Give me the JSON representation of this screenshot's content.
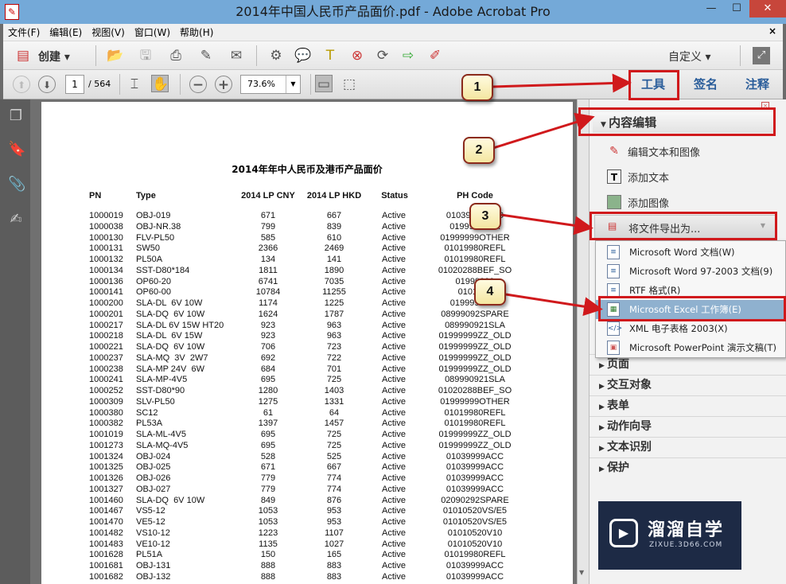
{
  "window": {
    "title": "2014年中国人民币产品面价.pdf - Adobe Acrobat Pro",
    "minimize": "—",
    "maximize": "☐",
    "close": "✕"
  },
  "menu": {
    "items": [
      "文件(F)",
      "编辑(E)",
      "视图(V)",
      "窗口(W)",
      "帮助(H)"
    ],
    "close": "×"
  },
  "toolbar": {
    "create_label": "创建 ▾",
    "customize_label": "自定义 ▾",
    "icons": [
      "open-icon",
      "save-icon",
      "print-icon",
      "edit-icon",
      "email-icon",
      "gear-icon",
      "comment-icon",
      "typewriter-icon",
      "delete-page-icon",
      "ocr-icon",
      "export-icon",
      "edit-pdf-icon"
    ]
  },
  "nav": {
    "page_current": "1",
    "page_total": "/ 564",
    "zoom": "73.6%"
  },
  "right_tabs": {
    "tools": "工具",
    "sign": "签名",
    "comment": "注释"
  },
  "panel": {
    "section_title": "内容编辑",
    "items": [
      "编辑文本和图像",
      "添加文本",
      "添加图像"
    ],
    "export_label": "将文件导出为...",
    "export_options": [
      "Microsoft Word 文档(W)",
      "Microsoft Word 97-2003 文档(9)",
      "RTF 格式(R)",
      "Microsoft Excel 工作簿(E)",
      "XML 电子表格 2003(X)",
      "Microsoft PowerPoint 演示文稿(T)"
    ],
    "sections": [
      "页面",
      "交互对象",
      "表单",
      "动作向导",
      "文本识别",
      "保护"
    ]
  },
  "document": {
    "title": "2014年年中人民币及港币产品面价",
    "headers": [
      "PN",
      "Type",
      "2014 LP CNY",
      "2014 LP HKD",
      "Status",
      "PH Code"
    ],
    "rows": [
      [
        "1000019",
        "OBJ-019",
        "671",
        "667",
        "Active",
        "01039999ACC"
      ],
      [
        "1000038",
        "OBJ-NR.38",
        "799",
        "839",
        "Active",
        "01999999XX"
      ],
      [
        "1000130",
        "FLV-PL50",
        "585",
        "610",
        "Active",
        "01999999OTHER"
      ],
      [
        "1000131",
        "SW50",
        "2366",
        "2469",
        "Active",
        "01019980REFL"
      ],
      [
        "1000132",
        "PL50A",
        "134",
        "141",
        "Active",
        "01019980REFL"
      ],
      [
        "1000134",
        "SST-D80*184",
        "1811",
        "1890",
        "Active",
        "01020288BEF_SO"
      ],
      [
        "1000136",
        "OP60-20",
        "6741",
        "7035",
        "Active",
        "01999999"
      ],
      [
        "1000141",
        "OP60-00",
        "10784",
        "11255",
        "Active",
        "0101998"
      ],
      [
        "1000200",
        "SLA-DL  6V 10W",
        "1174",
        "1225",
        "Active",
        "01999999ZZ"
      ],
      [
        "1000201",
        "SLA-DQ  6V 10W",
        "1624",
        "1787",
        "Active",
        "08999092SPARE"
      ],
      [
        "1000217",
        "SLA-DL 6V 15W HT20",
        "923",
        "963",
        "Active",
        "089990921SLA"
      ],
      [
        "1000218",
        "SLA-DL  6V 15W",
        "923",
        "963",
        "Active",
        "01999999ZZ_OLD"
      ],
      [
        "1000221",
        "SLA-DQ  6V 10W",
        "706",
        "723",
        "Active",
        "01999999ZZ_OLD"
      ],
      [
        "1000237",
        "SLA-MQ  3V  2W7",
        "692",
        "722",
        "Active",
        "01999999ZZ_OLD"
      ],
      [
        "1000238",
        "SLA-MP 24V  6W",
        "684",
        "701",
        "Active",
        "01999999ZZ_OLD"
      ],
      [
        "1000241",
        "SLA-MP-4V5",
        "695",
        "725",
        "Active",
        "089990921SLA"
      ],
      [
        "1000252",
        "SST-D80*90",
        "1280",
        "1403",
        "Active",
        "01020288BEF_SO"
      ],
      [
        "1000309",
        "SLV-PL50",
        "1275",
        "1331",
        "Active",
        "01999999OTHER"
      ],
      [
        "1000380",
        "SC12",
        "61",
        "64",
        "Active",
        "01019980REFL"
      ],
      [
        "1000382",
        "PL53A",
        "1397",
        "1457",
        "Active",
        "01019980REFL"
      ],
      [
        "1001019",
        "SLA-ML-4V5",
        "695",
        "725",
        "Active",
        "01999999ZZ_OLD"
      ],
      [
        "1001273",
        "SLA-MQ-4V5",
        "695",
        "725",
        "Active",
        "01999999ZZ_OLD"
      ],
      [
        "1001324",
        "OBJ-024",
        "528",
        "525",
        "Active",
        "01039999ACC"
      ],
      [
        "1001325",
        "OBJ-025",
        "671",
        "667",
        "Active",
        "01039999ACC"
      ],
      [
        "1001326",
        "OBJ-026",
        "779",
        "774",
        "Active",
        "01039999ACC"
      ],
      [
        "1001327",
        "OBJ-027",
        "779",
        "774",
        "Active",
        "01039999ACC"
      ],
      [
        "1001460",
        "SLA-DQ  6V 10W",
        "849",
        "876",
        "Active",
        "02090292SPARE"
      ],
      [
        "1001467",
        "VS5-12",
        "1053",
        "953",
        "Active",
        "01010520VS/E5"
      ],
      [
        "1001470",
        "VE5-12",
        "1053",
        "953",
        "Active",
        "01010520VS/E5"
      ],
      [
        "1001482",
        "VS10-12",
        "1223",
        "1107",
        "Active",
        "01010520V10"
      ],
      [
        "1001483",
        "VE10-12",
        "1135",
        "1027",
        "Active",
        "01010520V10"
      ],
      [
        "1001628",
        "PL51A",
        "150",
        "165",
        "Active",
        "01019980REFL"
      ],
      [
        "1001681",
        "OBJ-131",
        "888",
        "883",
        "Active",
        "01039999ACC"
      ],
      [
        "1001682",
        "OBJ-132",
        "888",
        "883",
        "Active",
        "01039999ACC"
      ]
    ]
  },
  "callouts": [
    "1",
    "2",
    "3",
    "4"
  ],
  "watermark": {
    "brand": "溜溜自学",
    "url": "ZIXUE.3D66.COM"
  },
  "colors": {
    "annotation_red": "#d0191c",
    "titlebar": "#74a9d8",
    "highlight": "#8fb1cf"
  }
}
